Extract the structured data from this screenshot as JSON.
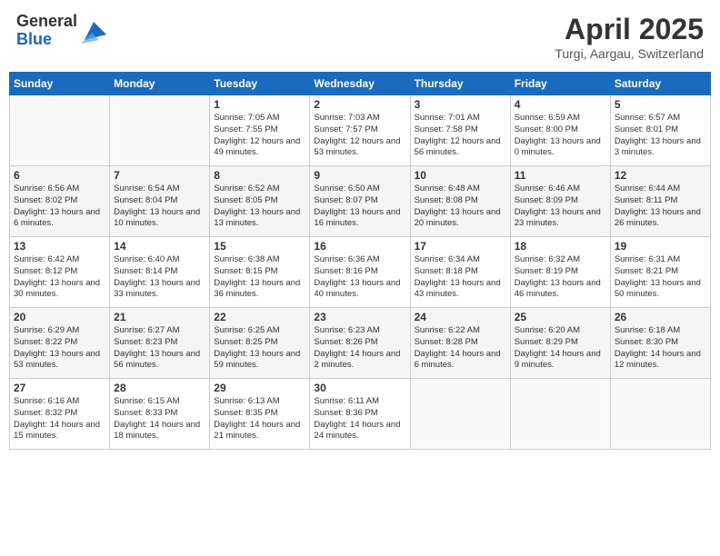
{
  "header": {
    "logo_general": "General",
    "logo_blue": "Blue",
    "month_year": "April 2025",
    "location": "Turgi, Aargau, Switzerland"
  },
  "weekdays": [
    "Sunday",
    "Monday",
    "Tuesday",
    "Wednesday",
    "Thursday",
    "Friday",
    "Saturday"
  ],
  "weeks": [
    [
      {
        "day": "",
        "info": ""
      },
      {
        "day": "",
        "info": ""
      },
      {
        "day": "1",
        "info": "Sunrise: 7:05 AM\nSunset: 7:55 PM\nDaylight: 12 hours and 49 minutes."
      },
      {
        "day": "2",
        "info": "Sunrise: 7:03 AM\nSunset: 7:57 PM\nDaylight: 12 hours and 53 minutes."
      },
      {
        "day": "3",
        "info": "Sunrise: 7:01 AM\nSunset: 7:58 PM\nDaylight: 12 hours and 56 minutes."
      },
      {
        "day": "4",
        "info": "Sunrise: 6:59 AM\nSunset: 8:00 PM\nDaylight: 13 hours and 0 minutes."
      },
      {
        "day": "5",
        "info": "Sunrise: 6:57 AM\nSunset: 8:01 PM\nDaylight: 13 hours and 3 minutes."
      }
    ],
    [
      {
        "day": "6",
        "info": "Sunrise: 6:56 AM\nSunset: 8:02 PM\nDaylight: 13 hours and 6 minutes."
      },
      {
        "day": "7",
        "info": "Sunrise: 6:54 AM\nSunset: 8:04 PM\nDaylight: 13 hours and 10 minutes."
      },
      {
        "day": "8",
        "info": "Sunrise: 6:52 AM\nSunset: 8:05 PM\nDaylight: 13 hours and 13 minutes."
      },
      {
        "day": "9",
        "info": "Sunrise: 6:50 AM\nSunset: 8:07 PM\nDaylight: 13 hours and 16 minutes."
      },
      {
        "day": "10",
        "info": "Sunrise: 6:48 AM\nSunset: 8:08 PM\nDaylight: 13 hours and 20 minutes."
      },
      {
        "day": "11",
        "info": "Sunrise: 6:46 AM\nSunset: 8:09 PM\nDaylight: 13 hours and 23 minutes."
      },
      {
        "day": "12",
        "info": "Sunrise: 6:44 AM\nSunset: 8:11 PM\nDaylight: 13 hours and 26 minutes."
      }
    ],
    [
      {
        "day": "13",
        "info": "Sunrise: 6:42 AM\nSunset: 8:12 PM\nDaylight: 13 hours and 30 minutes."
      },
      {
        "day": "14",
        "info": "Sunrise: 6:40 AM\nSunset: 8:14 PM\nDaylight: 13 hours and 33 minutes."
      },
      {
        "day": "15",
        "info": "Sunrise: 6:38 AM\nSunset: 8:15 PM\nDaylight: 13 hours and 36 minutes."
      },
      {
        "day": "16",
        "info": "Sunrise: 6:36 AM\nSunset: 8:16 PM\nDaylight: 13 hours and 40 minutes."
      },
      {
        "day": "17",
        "info": "Sunrise: 6:34 AM\nSunset: 8:18 PM\nDaylight: 13 hours and 43 minutes."
      },
      {
        "day": "18",
        "info": "Sunrise: 6:32 AM\nSunset: 8:19 PM\nDaylight: 13 hours and 46 minutes."
      },
      {
        "day": "19",
        "info": "Sunrise: 6:31 AM\nSunset: 8:21 PM\nDaylight: 13 hours and 50 minutes."
      }
    ],
    [
      {
        "day": "20",
        "info": "Sunrise: 6:29 AM\nSunset: 8:22 PM\nDaylight: 13 hours and 53 minutes."
      },
      {
        "day": "21",
        "info": "Sunrise: 6:27 AM\nSunset: 8:23 PM\nDaylight: 13 hours and 56 minutes."
      },
      {
        "day": "22",
        "info": "Sunrise: 6:25 AM\nSunset: 8:25 PM\nDaylight: 13 hours and 59 minutes."
      },
      {
        "day": "23",
        "info": "Sunrise: 6:23 AM\nSunset: 8:26 PM\nDaylight: 14 hours and 2 minutes."
      },
      {
        "day": "24",
        "info": "Sunrise: 6:22 AM\nSunset: 8:28 PM\nDaylight: 14 hours and 6 minutes."
      },
      {
        "day": "25",
        "info": "Sunrise: 6:20 AM\nSunset: 8:29 PM\nDaylight: 14 hours and 9 minutes."
      },
      {
        "day": "26",
        "info": "Sunrise: 6:18 AM\nSunset: 8:30 PM\nDaylight: 14 hours and 12 minutes."
      }
    ],
    [
      {
        "day": "27",
        "info": "Sunrise: 6:16 AM\nSunset: 8:32 PM\nDaylight: 14 hours and 15 minutes."
      },
      {
        "day": "28",
        "info": "Sunrise: 6:15 AM\nSunset: 8:33 PM\nDaylight: 14 hours and 18 minutes."
      },
      {
        "day": "29",
        "info": "Sunrise: 6:13 AM\nSunset: 8:35 PM\nDaylight: 14 hours and 21 minutes."
      },
      {
        "day": "30",
        "info": "Sunrise: 6:11 AM\nSunset: 8:36 PM\nDaylight: 14 hours and 24 minutes."
      },
      {
        "day": "",
        "info": ""
      },
      {
        "day": "",
        "info": ""
      },
      {
        "day": "",
        "info": ""
      }
    ]
  ]
}
